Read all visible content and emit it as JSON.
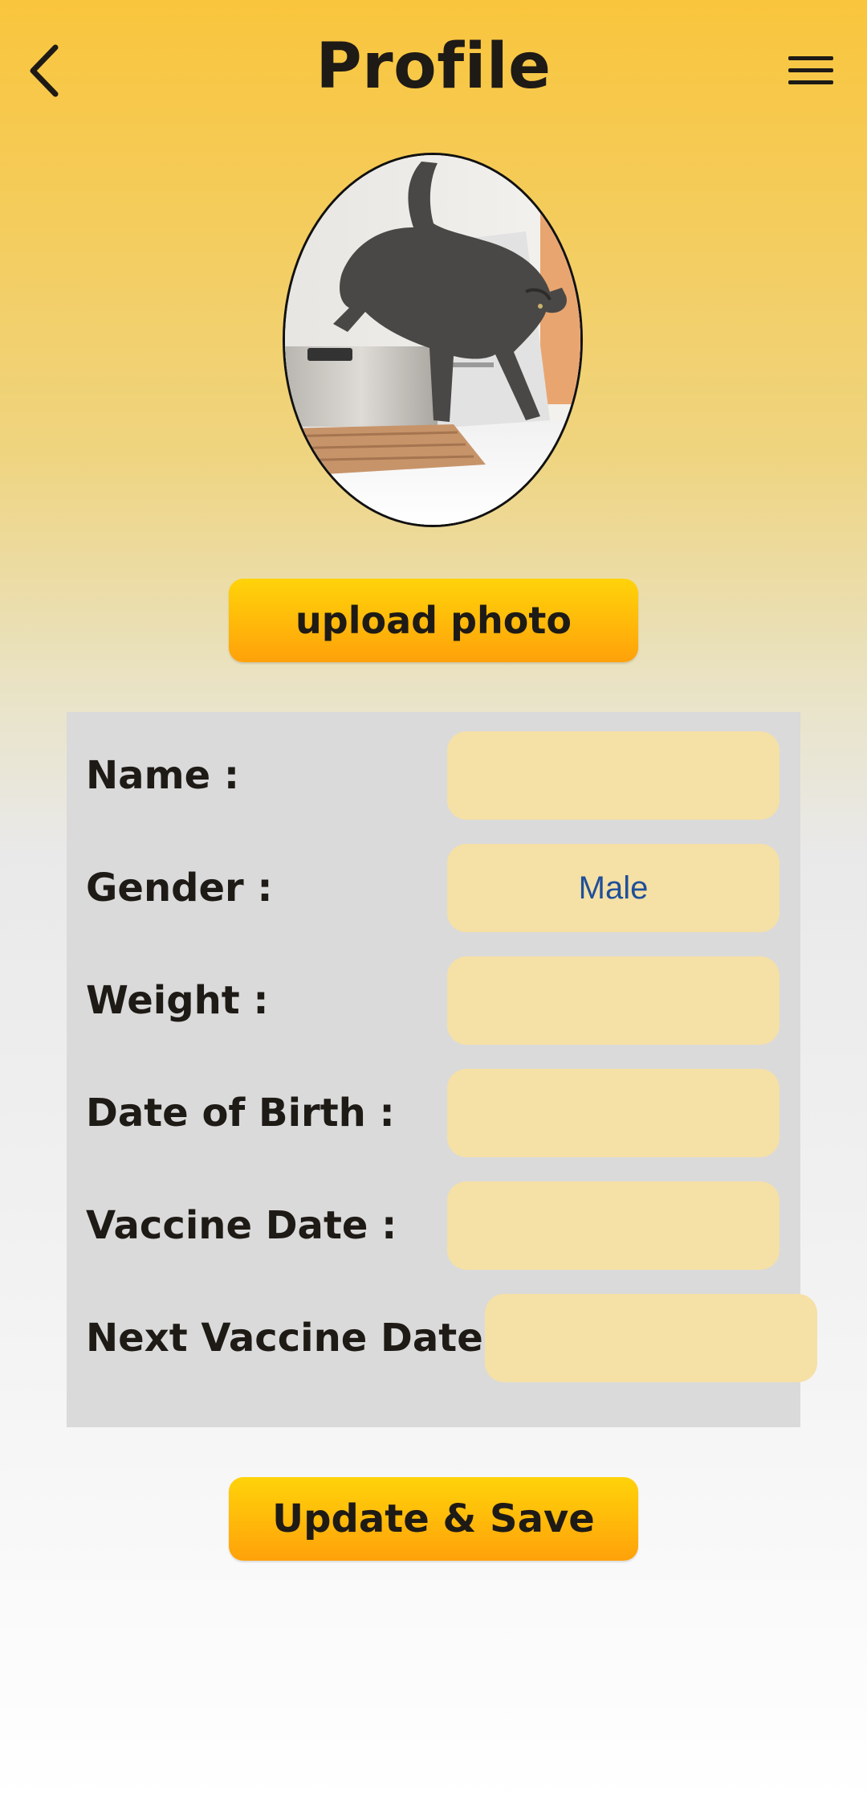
{
  "header": {
    "title": "Profile",
    "back_icon": "chevron-left-icon",
    "menu_icon": "hamburger-menu-icon"
  },
  "avatar": {
    "description_icon": "cat-photo"
  },
  "upload_button": {
    "label": "upload photo"
  },
  "form": {
    "fields": [
      {
        "label": "Name :",
        "value": ""
      },
      {
        "label": "Gender :",
        "value": "Male"
      },
      {
        "label": "Weight :",
        "value": ""
      },
      {
        "label": "Date of Birth :",
        "value": ""
      },
      {
        "label": "Vaccine Date :",
        "value": ""
      },
      {
        "label": "Next Vaccine Date :",
        "value": ""
      }
    ]
  },
  "save_button": {
    "label": "Update & Save"
  },
  "colors": {
    "accent": "#ffb80a",
    "field_bg": "#f5e0a6",
    "panel_bg": "#dadada",
    "value_text": "#1f4f9a"
  }
}
